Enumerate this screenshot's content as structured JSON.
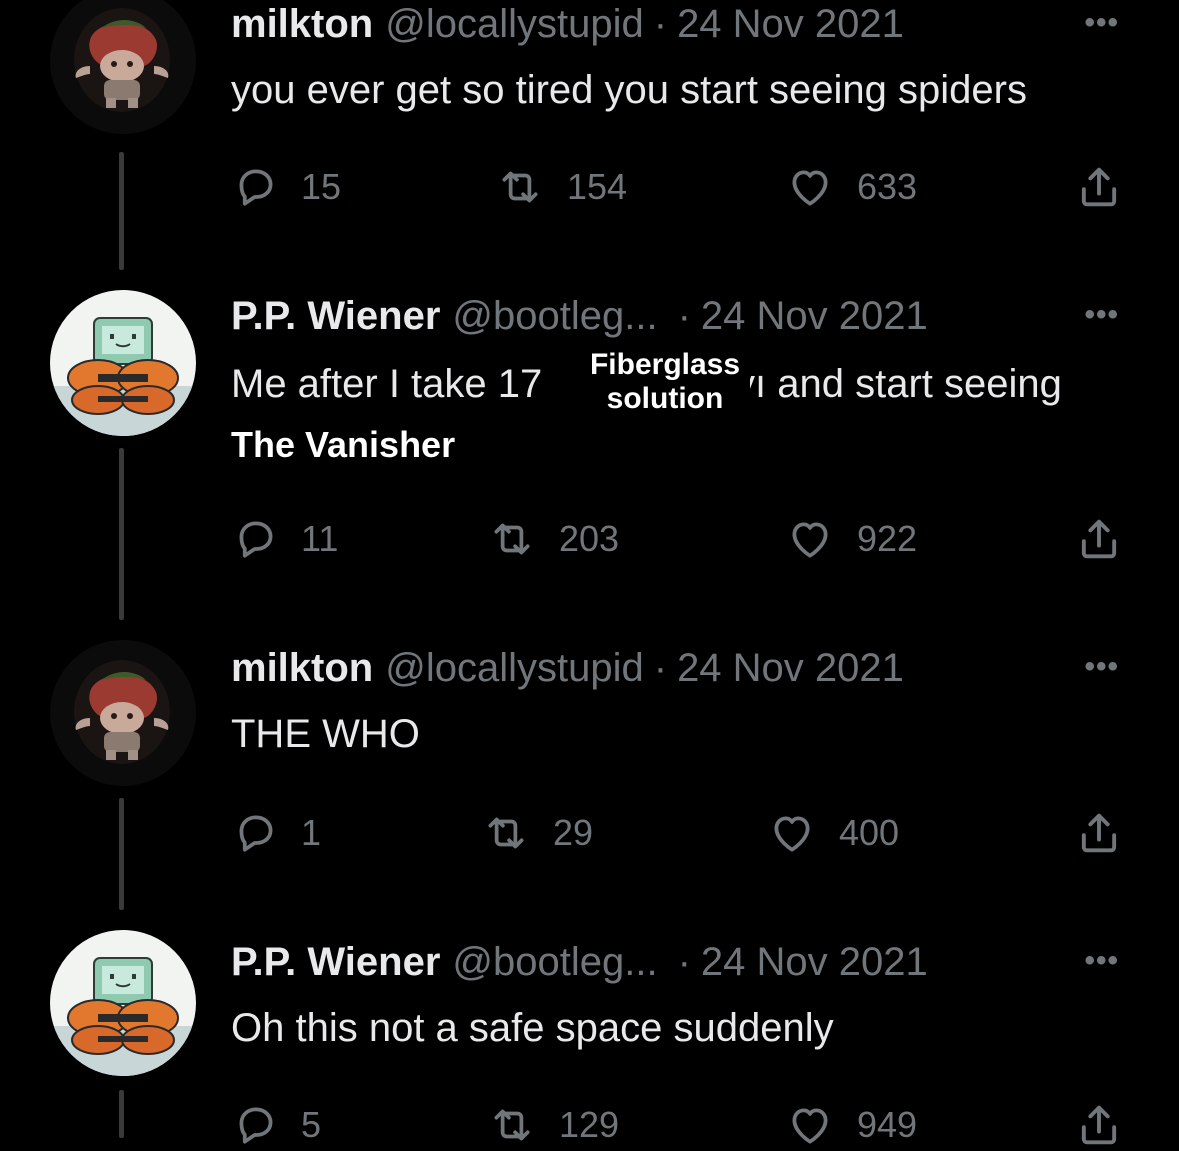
{
  "tweets": [
    {
      "display_name": "milkton",
      "handle": "@locallystupid",
      "separator": "·",
      "date": "24 Nov 2021",
      "more": "•••",
      "text": "you ever get so tired you start seeing spiders",
      "replies": "15",
      "retweets": "154",
      "likes": "633",
      "avatar": "strawberry-character-avatar"
    },
    {
      "display_name": "P.P. Wiener",
      "handle": "@bootleg...",
      "separator": "·",
      "date": "24 Nov 2021",
      "more": "•••",
      "text_before": "Me after I take 17",
      "text_after": "yı and start seeing",
      "overlay_caption_line1": "Fiberglass",
      "overlay_caption_line2": "solution",
      "overlay_title": "The Vanisher",
      "replies": "11",
      "retweets": "203",
      "likes": "922",
      "avatar": "bmo-character-avatar"
    },
    {
      "display_name": "milkton",
      "handle": "@locallystupid",
      "separator": "·",
      "date": "24 Nov 2021",
      "more": "•••",
      "text": "THE WHO",
      "replies": "1",
      "retweets": "29",
      "likes": "400",
      "avatar": "strawberry-character-avatar"
    },
    {
      "display_name": "P.P. Wiener",
      "handle": "@bootleg...",
      "separator": "·",
      "date": "24 Nov 2021",
      "more": "•••",
      "text": "Oh this not a safe space suddenly",
      "replies": "5",
      "retweets": "129",
      "likes": "949",
      "avatar": "bmo-character-avatar"
    }
  ],
  "colors": {
    "background": "#000000",
    "primary_text": "#e7e9ea",
    "secondary_text": "#71767b",
    "thread_line": "#3a3a3a"
  },
  "icons": [
    "reply-icon",
    "retweet-icon",
    "like-icon",
    "share-icon",
    "more-icon"
  ]
}
